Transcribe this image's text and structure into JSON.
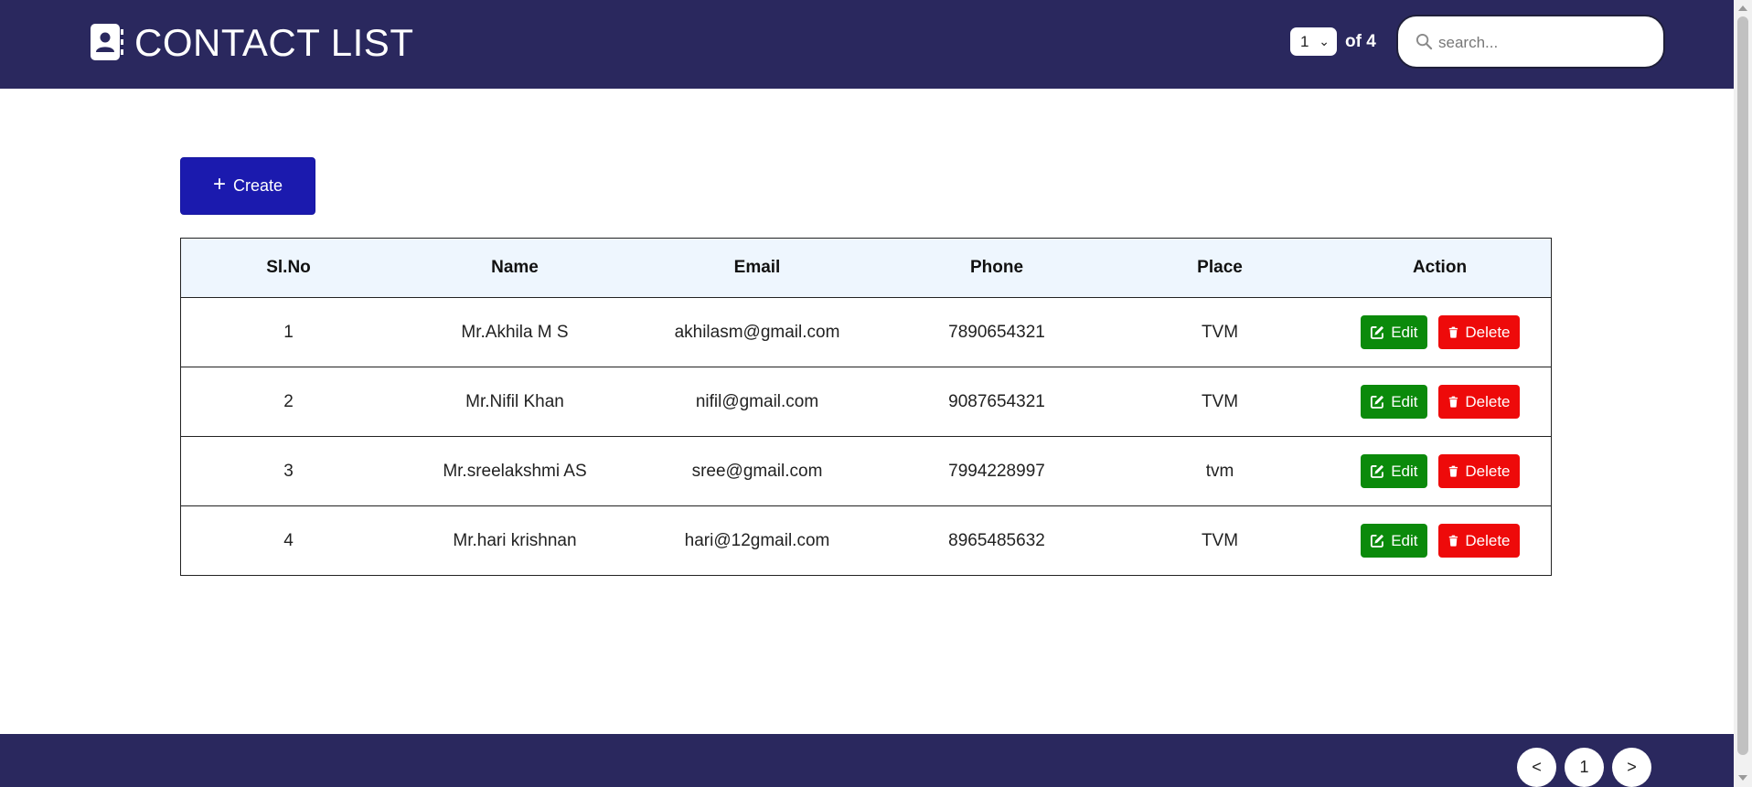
{
  "header": {
    "title": "CONTACT LIST",
    "logo_icon": "contact-book-icon",
    "page_select_value": "1",
    "page_total_label": "of 4",
    "search_placeholder": "search..."
  },
  "toolbar": {
    "create_label": "Create"
  },
  "table": {
    "columns": [
      "Sl.No",
      "Name",
      "Email",
      "Phone",
      "Place",
      "Action"
    ],
    "rows": [
      {
        "slno": "1",
        "name": "Mr.Akhila M S",
        "email": "akhilasm@gmail.com",
        "phone": "7890654321",
        "place": "TVM"
      },
      {
        "slno": "2",
        "name": "Mr.Nifil Khan",
        "email": "nifil@gmail.com",
        "phone": "9087654321",
        "place": "TVM"
      },
      {
        "slno": "3",
        "name": "Mr.sreelakshmi AS",
        "email": "sree@gmail.com",
        "phone": "7994228997",
        "place": "tvm"
      },
      {
        "slno": "4",
        "name": "Mr.hari krishnan",
        "email": "hari@12gmail.com",
        "phone": "8965485632",
        "place": "TVM"
      }
    ],
    "edit_label": "Edit",
    "delete_label": "Delete"
  },
  "pagination": {
    "prev": "<",
    "current": "1",
    "next": ">"
  },
  "colors": {
    "header_bg": "#2a285e",
    "create_button": "#1b1aae",
    "edit_button": "#0b8a0b",
    "delete_button": "#ee0a0a",
    "table_header_bg": "#eef6fe"
  }
}
